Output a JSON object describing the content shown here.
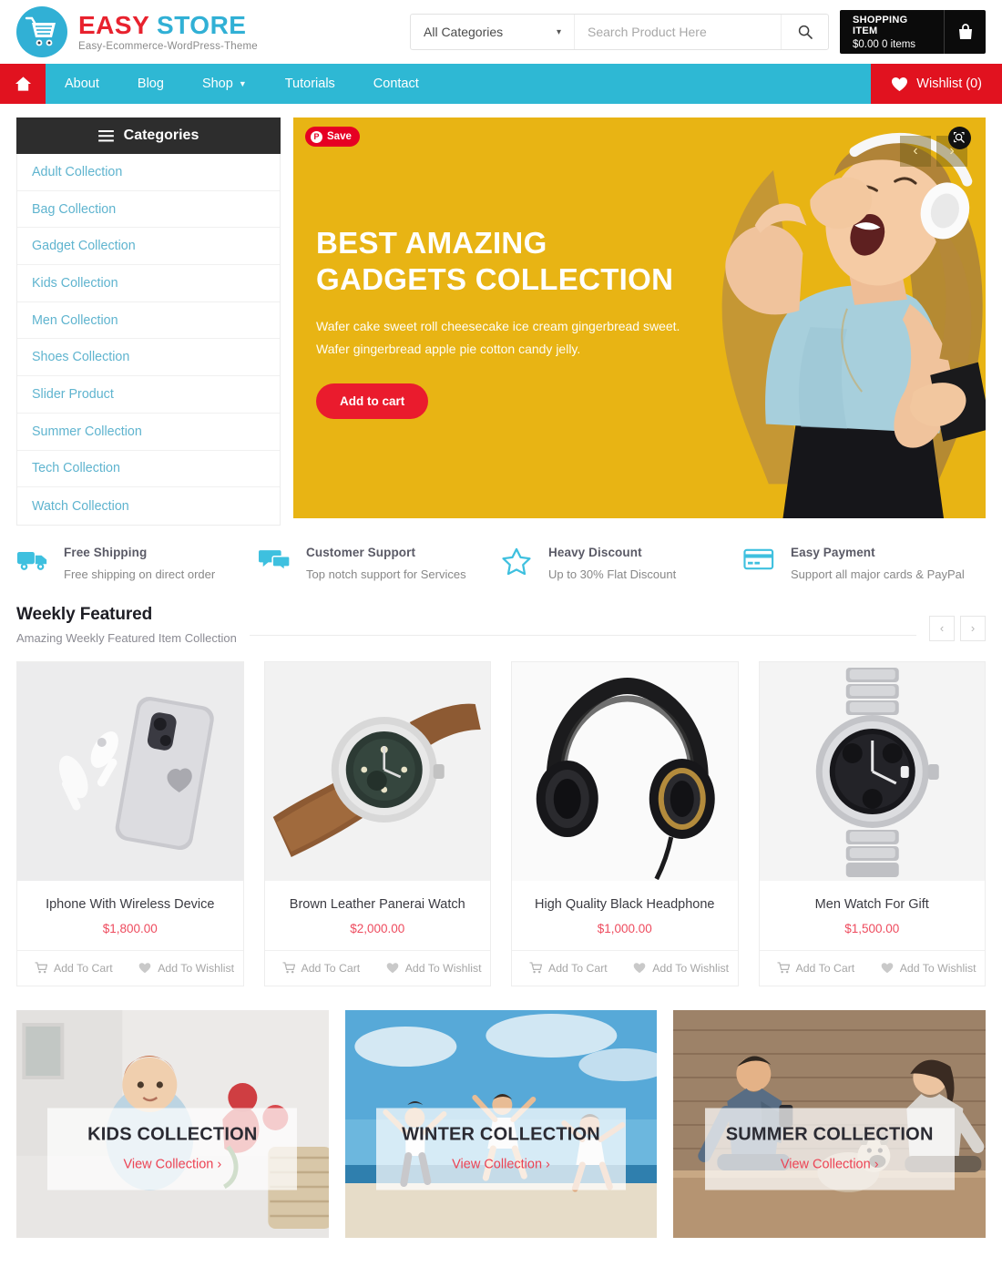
{
  "header": {
    "logo": {
      "part1": "EASY",
      "part2": "STORE",
      "tagline": "Easy-Ecommerce-WordPress-Theme",
      "icon": "shopping-cart-icon"
    },
    "search": {
      "category_selected": "All Categories",
      "placeholder": "Search Product Here",
      "search_icon": "search-icon",
      "chevron_icon": "chevron-down-icon"
    },
    "cart": {
      "label": "SHOPPING ITEM",
      "summary": "$0.00 0 items",
      "icon": "shopping-bag-icon"
    }
  },
  "nav": {
    "home_icon": "home-icon",
    "items": [
      {
        "label": "About",
        "has_dropdown": false
      },
      {
        "label": "Blog",
        "has_dropdown": false
      },
      {
        "label": "Shop",
        "has_dropdown": true
      },
      {
        "label": "Tutorials",
        "has_dropdown": false
      },
      {
        "label": "Contact",
        "has_dropdown": false
      }
    ],
    "wishlist": {
      "label": "Wishlist (0)",
      "icon": "heart-icon"
    }
  },
  "categories": {
    "header": "Categories",
    "menu_icon": "hamburger-icon",
    "items": [
      {
        "label": "Adult Collection"
      },
      {
        "label": "Bag Collection"
      },
      {
        "label": "Gadget Collection"
      },
      {
        "label": "Kids Collection"
      },
      {
        "label": "Men Collection"
      },
      {
        "label": "Shoes Collection"
      },
      {
        "label": "Slider Product"
      },
      {
        "label": "Summer Collection"
      },
      {
        "label": "Tech Collection"
      },
      {
        "label": "Watch Collection"
      }
    ]
  },
  "hero": {
    "title_line1": "BEST AMAZING",
    "title_line2": "GADGETS COLLECTION",
    "description": "Wafer cake sweet roll cheesecake ice cream gingerbread sweet. Wafer gingerbread apple pie cotton candy jelly.",
    "button_label": "Add to cart",
    "pin_save_label": "Save",
    "prev_arrow": "‹",
    "next_arrow": "›",
    "lens_icon": "visual-search-icon",
    "background_color": "#e8b414"
  },
  "features": [
    {
      "icon": "truck-icon",
      "title": "Free Shipping",
      "desc": "Free shipping on direct order"
    },
    {
      "icon": "chat-icon",
      "title": "Customer Support",
      "desc": "Top notch support for Services"
    },
    {
      "icon": "star-icon",
      "title": "Heavy Discount",
      "desc": "Up to 30% Flat Discount"
    },
    {
      "icon": "credit-card-icon",
      "title": "Easy Payment",
      "desc": "Support all major cards & PayPal"
    }
  ],
  "weekly": {
    "title": "Weekly Featured",
    "subtitle": "Amazing Weekly Featured Item Collection",
    "prev_arrow": "‹",
    "next_arrow": "›"
  },
  "products": [
    {
      "name": "Iphone With Wireless Device",
      "price": "$1,800.00",
      "cart_label": "Add To Cart",
      "wishlist_label": "Add To Wishlist",
      "image": "iphone-airpods-photo"
    },
    {
      "name": "Brown Leather Panerai Watch",
      "price": "$2,000.00",
      "cart_label": "Add To Cart",
      "wishlist_label": "Add To Wishlist",
      "image": "brown-leather-watch-photo"
    },
    {
      "name": "High Quality Black Headphone",
      "price": "$1,000.00",
      "cart_label": "Add To Cart",
      "wishlist_label": "Add To Wishlist",
      "image": "black-headphone-photo"
    },
    {
      "name": "Men Watch For Gift",
      "price": "$1,500.00",
      "cart_label": "Add To Cart",
      "wishlist_label": "Add To Wishlist",
      "image": "silver-chronograph-watch-photo"
    }
  ],
  "collections": [
    {
      "title": "KIDS COLLECTION",
      "link": "View Collection  ›",
      "image": "kids-room-photo"
    },
    {
      "title": "WINTER COLLECTION",
      "link": "View Collection  ›",
      "image": "beach-jumping-photo"
    },
    {
      "title": "SUMMER COLLECTION",
      "link": "View Collection  ›",
      "image": "couple-dog-photo"
    }
  ],
  "colors": {
    "teal": "#2eb8d4",
    "red": "#e1121f",
    "price_red": "#ee4b5e",
    "dark": "#2d2d2d",
    "hero_yellow": "#e8b414"
  }
}
